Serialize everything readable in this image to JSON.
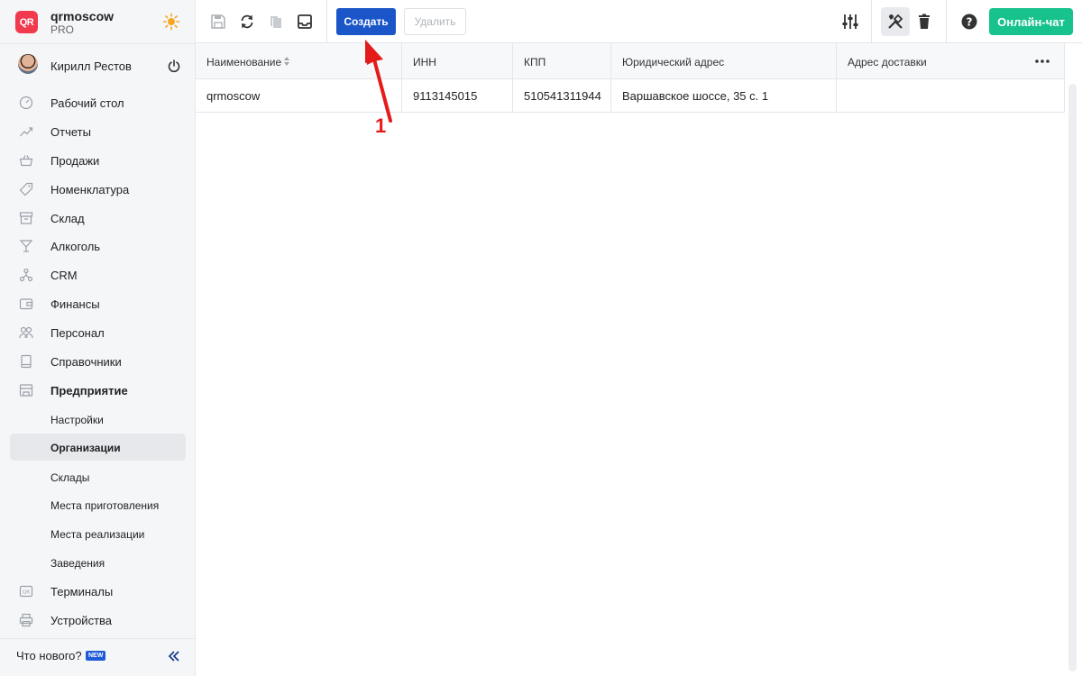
{
  "brand": {
    "logo_text": "QR",
    "name": "qrmoscow",
    "plan": "PRO"
  },
  "user": {
    "name": "Кирилл Рестов"
  },
  "nav": {
    "items": [
      {
        "label": "Рабочий стол",
        "icon": "dashboard-icon"
      },
      {
        "label": "Отчеты",
        "icon": "reports-icon"
      },
      {
        "label": "Продажи",
        "icon": "basket-icon"
      },
      {
        "label": "Номенклатура",
        "icon": "tag-icon"
      },
      {
        "label": "Склад",
        "icon": "warehouse-icon"
      },
      {
        "label": "Алкоголь",
        "icon": "cocktail-icon"
      },
      {
        "label": "CRM",
        "icon": "crm-icon"
      },
      {
        "label": "Финансы",
        "icon": "wallet-icon"
      },
      {
        "label": "Персонал",
        "icon": "staff-icon"
      },
      {
        "label": "Справочники",
        "icon": "book-icon"
      },
      {
        "label": "Предприятие",
        "icon": "store-icon"
      }
    ],
    "sub_items": [
      {
        "label": "Настройки"
      },
      {
        "label": "Организации"
      },
      {
        "label": "Склады"
      },
      {
        "label": "Места приготовления"
      },
      {
        "label": "Места реализации"
      },
      {
        "label": "Заведения"
      }
    ],
    "bottom_items": [
      {
        "label": "Терминалы",
        "icon": "terminal-icon"
      },
      {
        "label": "Устройства",
        "icon": "printer-icon"
      }
    ]
  },
  "footer": {
    "whats_new": "Что нового?",
    "badge": "NEW"
  },
  "toolbar": {
    "create_label": "Создать",
    "delete_label": "Удалить",
    "chat_label": "Онлайн-чат"
  },
  "table": {
    "columns": [
      "Наименование",
      "ИНН",
      "КПП",
      "Юридический адрес",
      "Адрес доставки"
    ],
    "rows": [
      [
        "qrmoscow",
        "9113145015",
        "510541311944",
        "Варшавское шоссе, 35 с. 1",
        ""
      ]
    ]
  },
  "annotation": {
    "number": "1"
  },
  "colors": {
    "primary": "#1a56c8",
    "chat": "#17c28d",
    "logo": "#f23a4f",
    "annotation": "#e31b1b"
  }
}
